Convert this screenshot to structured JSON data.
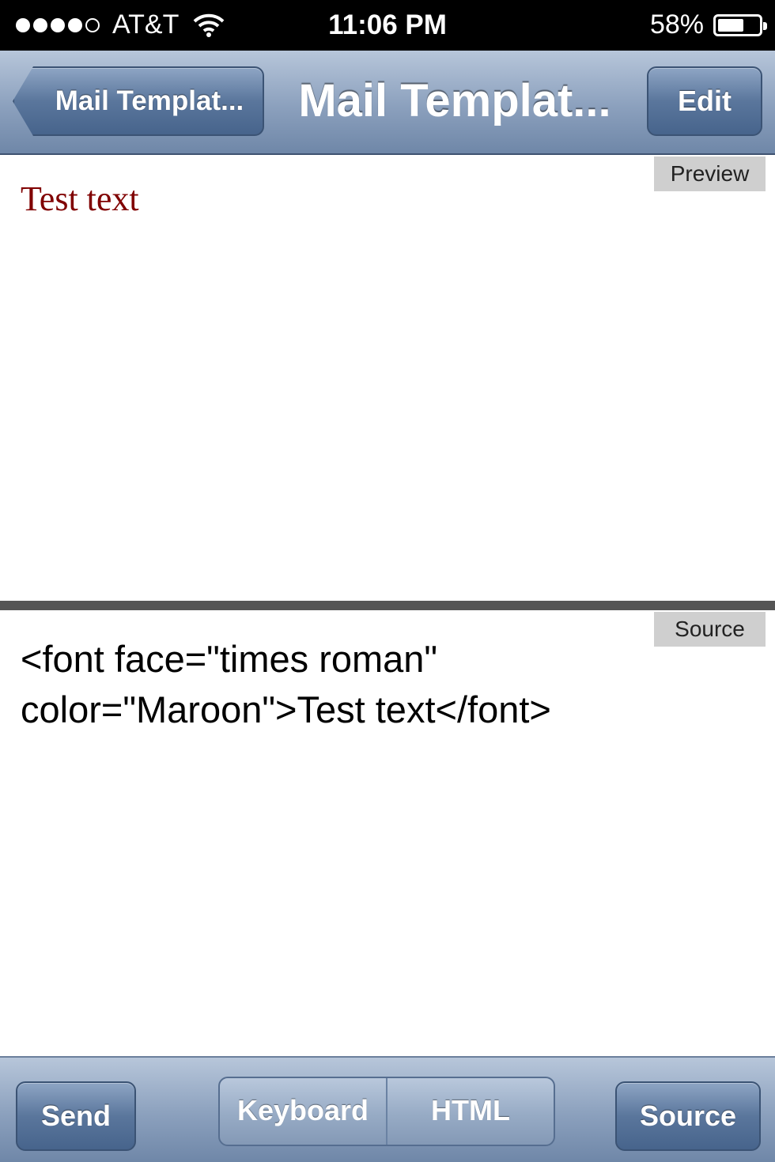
{
  "status_bar": {
    "carrier": "AT&T",
    "signal_bars": 4,
    "time": "11:06 PM",
    "battery_percent": "58%",
    "battery_level": 0.58
  },
  "nav": {
    "back_label": "Mail Templat...",
    "title": "Mail Templat...",
    "edit_label": "Edit"
  },
  "preview": {
    "tag": "Preview",
    "text": "Test text",
    "text_color": "#800000"
  },
  "source": {
    "tag": "Source",
    "code": "<font face=\"times roman\" color=\"Maroon\">Test text</font>"
  },
  "toolbar": {
    "send_label": "Send",
    "segments": [
      "Keyboard",
      "HTML"
    ],
    "source_label": "Source"
  },
  "colors": {
    "bar_gradient_top": "#b7c6da",
    "bar_gradient_bottom": "#6f87a8",
    "button_blue": "#47648c"
  }
}
